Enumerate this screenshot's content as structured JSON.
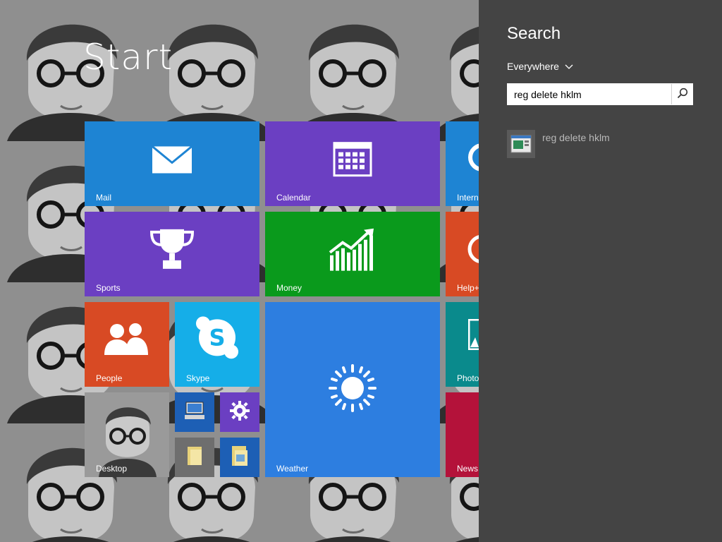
{
  "start": {
    "title": "Start"
  },
  "tiles": {
    "mail": {
      "label": "Mail",
      "color": "#1e84d3",
      "icon": "mail-icon"
    },
    "calendar": {
      "label": "Calendar",
      "color": "#6b3fc2",
      "icon": "calendar-icon"
    },
    "internet": {
      "label": "Intern",
      "color": "#1e84d3",
      "icon": "internet-explorer-icon"
    },
    "sports": {
      "label": "Sports",
      "color": "#6b3fc2",
      "icon": "trophy-icon"
    },
    "money": {
      "label": "Money",
      "color": "#0a9a1c",
      "icon": "chart-icon"
    },
    "help": {
      "label": "Help+",
      "color": "#d84a24",
      "icon": "help-icon"
    },
    "people": {
      "label": "People",
      "color": "#d84a24",
      "icon": "people-icon"
    },
    "skype": {
      "label": "Skype",
      "color": "#15aee8",
      "icon": "skype-icon"
    },
    "weather": {
      "label": "Weather",
      "color": "#2d7ee0",
      "icon": "sun-icon"
    },
    "photos": {
      "label": "Photo",
      "color": "#0a8a8c",
      "icon": "photo-icon"
    },
    "desktop": {
      "label": "Desktop",
      "icon": "desktop-icon"
    },
    "news": {
      "label": "News",
      "color": "#b4123a",
      "icon": "news-icon"
    },
    "small": [
      {
        "name": "this-pc-tile",
        "icon": "computer-icon",
        "color": "#1d5fb5"
      },
      {
        "name": "pc-settings-tile",
        "icon": "gear-icon",
        "color": "#6b3fc2"
      },
      {
        "name": "file-explorer-tile",
        "icon": "folder-icon",
        "color": "#6e6e6e"
      },
      {
        "name": "documents-tile",
        "icon": "folder-icon",
        "color": "#1d5fb5"
      }
    ]
  },
  "search": {
    "heading": "Search",
    "scope": "Everywhere",
    "query": "reg delete hklm",
    "results": [
      {
        "label": "reg delete hklm",
        "icon": "command-icon"
      }
    ]
  }
}
